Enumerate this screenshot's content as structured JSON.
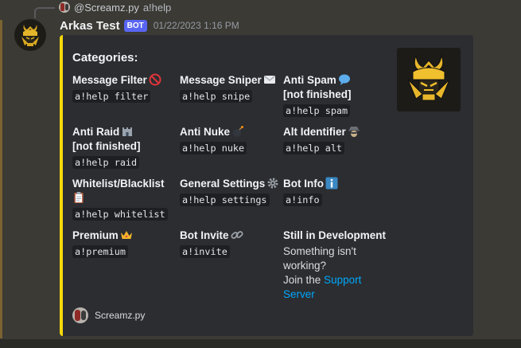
{
  "reply": {
    "name": "@Screamz.py",
    "text": "a!help"
  },
  "message": {
    "author": "Arkas Test",
    "badge": "BOT",
    "timestamp": "01/22/2023 1:16 PM"
  },
  "embed": {
    "accent_color": "#f5d90c",
    "title": "Categories:",
    "fields": [
      {
        "name": "Message Filter",
        "icon": "no-entry-icon",
        "value": "a!help filter"
      },
      {
        "name": "Message Sniper",
        "icon": "envelope-icon",
        "value": "a!help snipe"
      },
      {
        "name": "Anti Spam",
        "icon": "speech-bubble-icon",
        "note": "[not finished]",
        "value": "a!help spam"
      },
      {
        "name": "Anti Raid",
        "icon": "castle-icon",
        "note": "[not finished]",
        "value": "a!help raid"
      },
      {
        "name": "Anti Nuke",
        "icon": "bomb-icon",
        "value": "a!help nuke"
      },
      {
        "name": "Alt Identifier",
        "icon": "detective-icon",
        "value": "a!help alt"
      },
      {
        "name": "Whitelist/Blacklist",
        "icon": "clipboard-icon",
        "value": "a!help whitelist"
      },
      {
        "name": "General Settings",
        "icon": "gear-icon",
        "value": "a!help settings"
      },
      {
        "name": "Bot Info",
        "icon": "info-icon",
        "value": "a!info"
      },
      {
        "name": "Premium",
        "icon": "crown-icon",
        "value": "a!premium"
      },
      {
        "name": "Bot Invite",
        "icon": "link-icon",
        "value": "a!invite"
      },
      {
        "name": "Still in Development",
        "text1": "Something isn't working?",
        "text2": "Join the",
        "link": "Support Server"
      }
    ],
    "footer": "Screamz.py"
  }
}
